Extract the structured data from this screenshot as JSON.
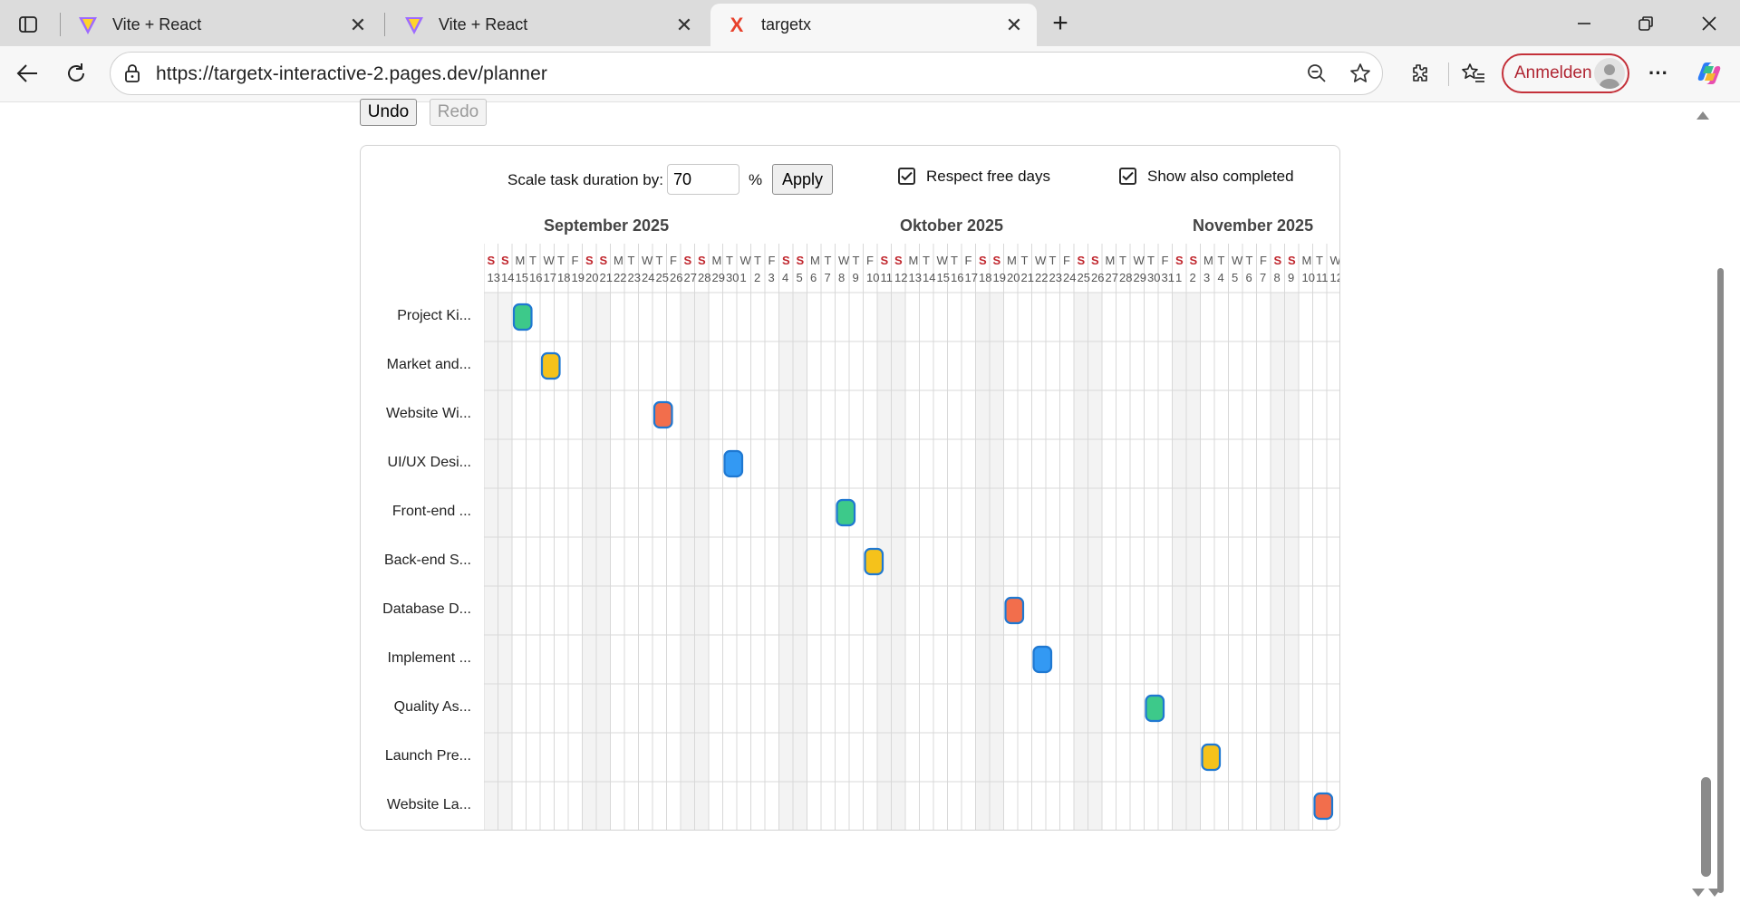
{
  "browser": {
    "tabs": [
      {
        "title": "Vite + React",
        "favicon": "vite-icon",
        "active": false
      },
      {
        "title": "Vite + React",
        "favicon": "vite-icon",
        "active": false
      },
      {
        "title": "targetx",
        "favicon": "targetx-x-icon",
        "active": true
      }
    ],
    "url": "https://targetx-interactive-2.pages.dev/planner",
    "signin_label": "Anmelden"
  },
  "toolbar": {
    "undo_label": "Undo",
    "redo_label": "Redo"
  },
  "controls": {
    "scale_label": "Scale task duration by:",
    "scale_value": "70",
    "percent_sign": "%",
    "apply_label": "Apply",
    "respect_free_days_label": "Respect free days",
    "respect_free_days_checked": true,
    "show_completed_label": "Show also completed",
    "show_completed_checked": true
  },
  "timeline": {
    "months": [
      "September 2025",
      "Oktober 2025",
      "November 2025"
    ],
    "days": [
      {
        "d": "S",
        "n": "13",
        "w": true
      },
      {
        "d": "S",
        "n": "14",
        "w": true
      },
      {
        "d": "M",
        "n": "15"
      },
      {
        "d": "T",
        "n": "16"
      },
      {
        "d": "W",
        "n": "17"
      },
      {
        "d": "T",
        "n": "18"
      },
      {
        "d": "F",
        "n": "19"
      },
      {
        "d": "S",
        "n": "20",
        "w": true
      },
      {
        "d": "S",
        "n": "21",
        "w": true
      },
      {
        "d": "M",
        "n": "22"
      },
      {
        "d": "T",
        "n": "23"
      },
      {
        "d": "W",
        "n": "24"
      },
      {
        "d": "T",
        "n": "25"
      },
      {
        "d": "F",
        "n": "26"
      },
      {
        "d": "S",
        "n": "27",
        "w": true
      },
      {
        "d": "S",
        "n": "28",
        "w": true
      },
      {
        "d": "M",
        "n": "29"
      },
      {
        "d": "T",
        "n": "30"
      },
      {
        "d": "W",
        "n": "1"
      },
      {
        "d": "T",
        "n": "2"
      },
      {
        "d": "F",
        "n": "3"
      },
      {
        "d": "S",
        "n": "4",
        "w": true
      },
      {
        "d": "S",
        "n": "5",
        "w": true
      },
      {
        "d": "M",
        "n": "6"
      },
      {
        "d": "T",
        "n": "7"
      },
      {
        "d": "W",
        "n": "8"
      },
      {
        "d": "T",
        "n": "9"
      },
      {
        "d": "F",
        "n": "10"
      },
      {
        "d": "S",
        "n": "11",
        "w": true
      },
      {
        "d": "S",
        "n": "12",
        "w": true
      },
      {
        "d": "M",
        "n": "13"
      },
      {
        "d": "T",
        "n": "14"
      },
      {
        "d": "W",
        "n": "15"
      },
      {
        "d": "T",
        "n": "16"
      },
      {
        "d": "F",
        "n": "17"
      },
      {
        "d": "S",
        "n": "18",
        "w": true
      },
      {
        "d": "S",
        "n": "19",
        "w": true
      },
      {
        "d": "M",
        "n": "20"
      },
      {
        "d": "T",
        "n": "21"
      },
      {
        "d": "W",
        "n": "22"
      },
      {
        "d": "T",
        "n": "23"
      },
      {
        "d": "F",
        "n": "24"
      },
      {
        "d": "S",
        "n": "25",
        "w": true
      },
      {
        "d": "S",
        "n": "26",
        "w": true
      },
      {
        "d": "M",
        "n": "27"
      },
      {
        "d": "T",
        "n": "28"
      },
      {
        "d": "W",
        "n": "29"
      },
      {
        "d": "T",
        "n": "30"
      },
      {
        "d": "F",
        "n": "31"
      },
      {
        "d": "S",
        "n": "1",
        "w": true
      },
      {
        "d": "S",
        "n": "2",
        "w": true
      },
      {
        "d": "M",
        "n": "3"
      },
      {
        "d": "T",
        "n": "4"
      },
      {
        "d": "W",
        "n": "5"
      },
      {
        "d": "T",
        "n": "6"
      },
      {
        "d": "F",
        "n": "7"
      },
      {
        "d": "S",
        "n": "8",
        "w": true
      },
      {
        "d": "S",
        "n": "9",
        "w": true
      },
      {
        "d": "M",
        "n": "10"
      },
      {
        "d": "T",
        "n": "11"
      },
      {
        "d": "W",
        "n": "12"
      }
    ]
  },
  "tasks": [
    {
      "label": "Project Ki...",
      "day_index": 2,
      "color": "#3dc98a"
    },
    {
      "label": "Market and...",
      "day_index": 4,
      "color": "#f5c21b"
    },
    {
      "label": "Website Wi...",
      "day_index": 12,
      "color": "#f26e4c"
    },
    {
      "label": "UI/UX Desi...",
      "day_index": 17,
      "color": "#3399f3"
    },
    {
      "label": "Front-end ...",
      "day_index": 25,
      "color": "#3dc98a"
    },
    {
      "label": "Back-end S...",
      "day_index": 27,
      "color": "#f5c21b"
    },
    {
      "label": "Database D...",
      "day_index": 37,
      "color": "#f26e4c"
    },
    {
      "label": "Implement ...",
      "day_index": 39,
      "color": "#3399f3"
    },
    {
      "label": "Quality As...",
      "day_index": 47,
      "color": "#3dc98a"
    },
    {
      "label": "Launch Pre...",
      "day_index": 51,
      "color": "#f5c21b"
    },
    {
      "label": "Website La...",
      "day_index": 59,
      "color": "#f26e4c"
    }
  ],
  "colors": {
    "bar_border": "#1f78d1",
    "weekend_text": "#c0262d",
    "weekday_text": "#555555",
    "grid_line": "#d8d8d8",
    "weekend_fill": "#f3f3f3"
  }
}
